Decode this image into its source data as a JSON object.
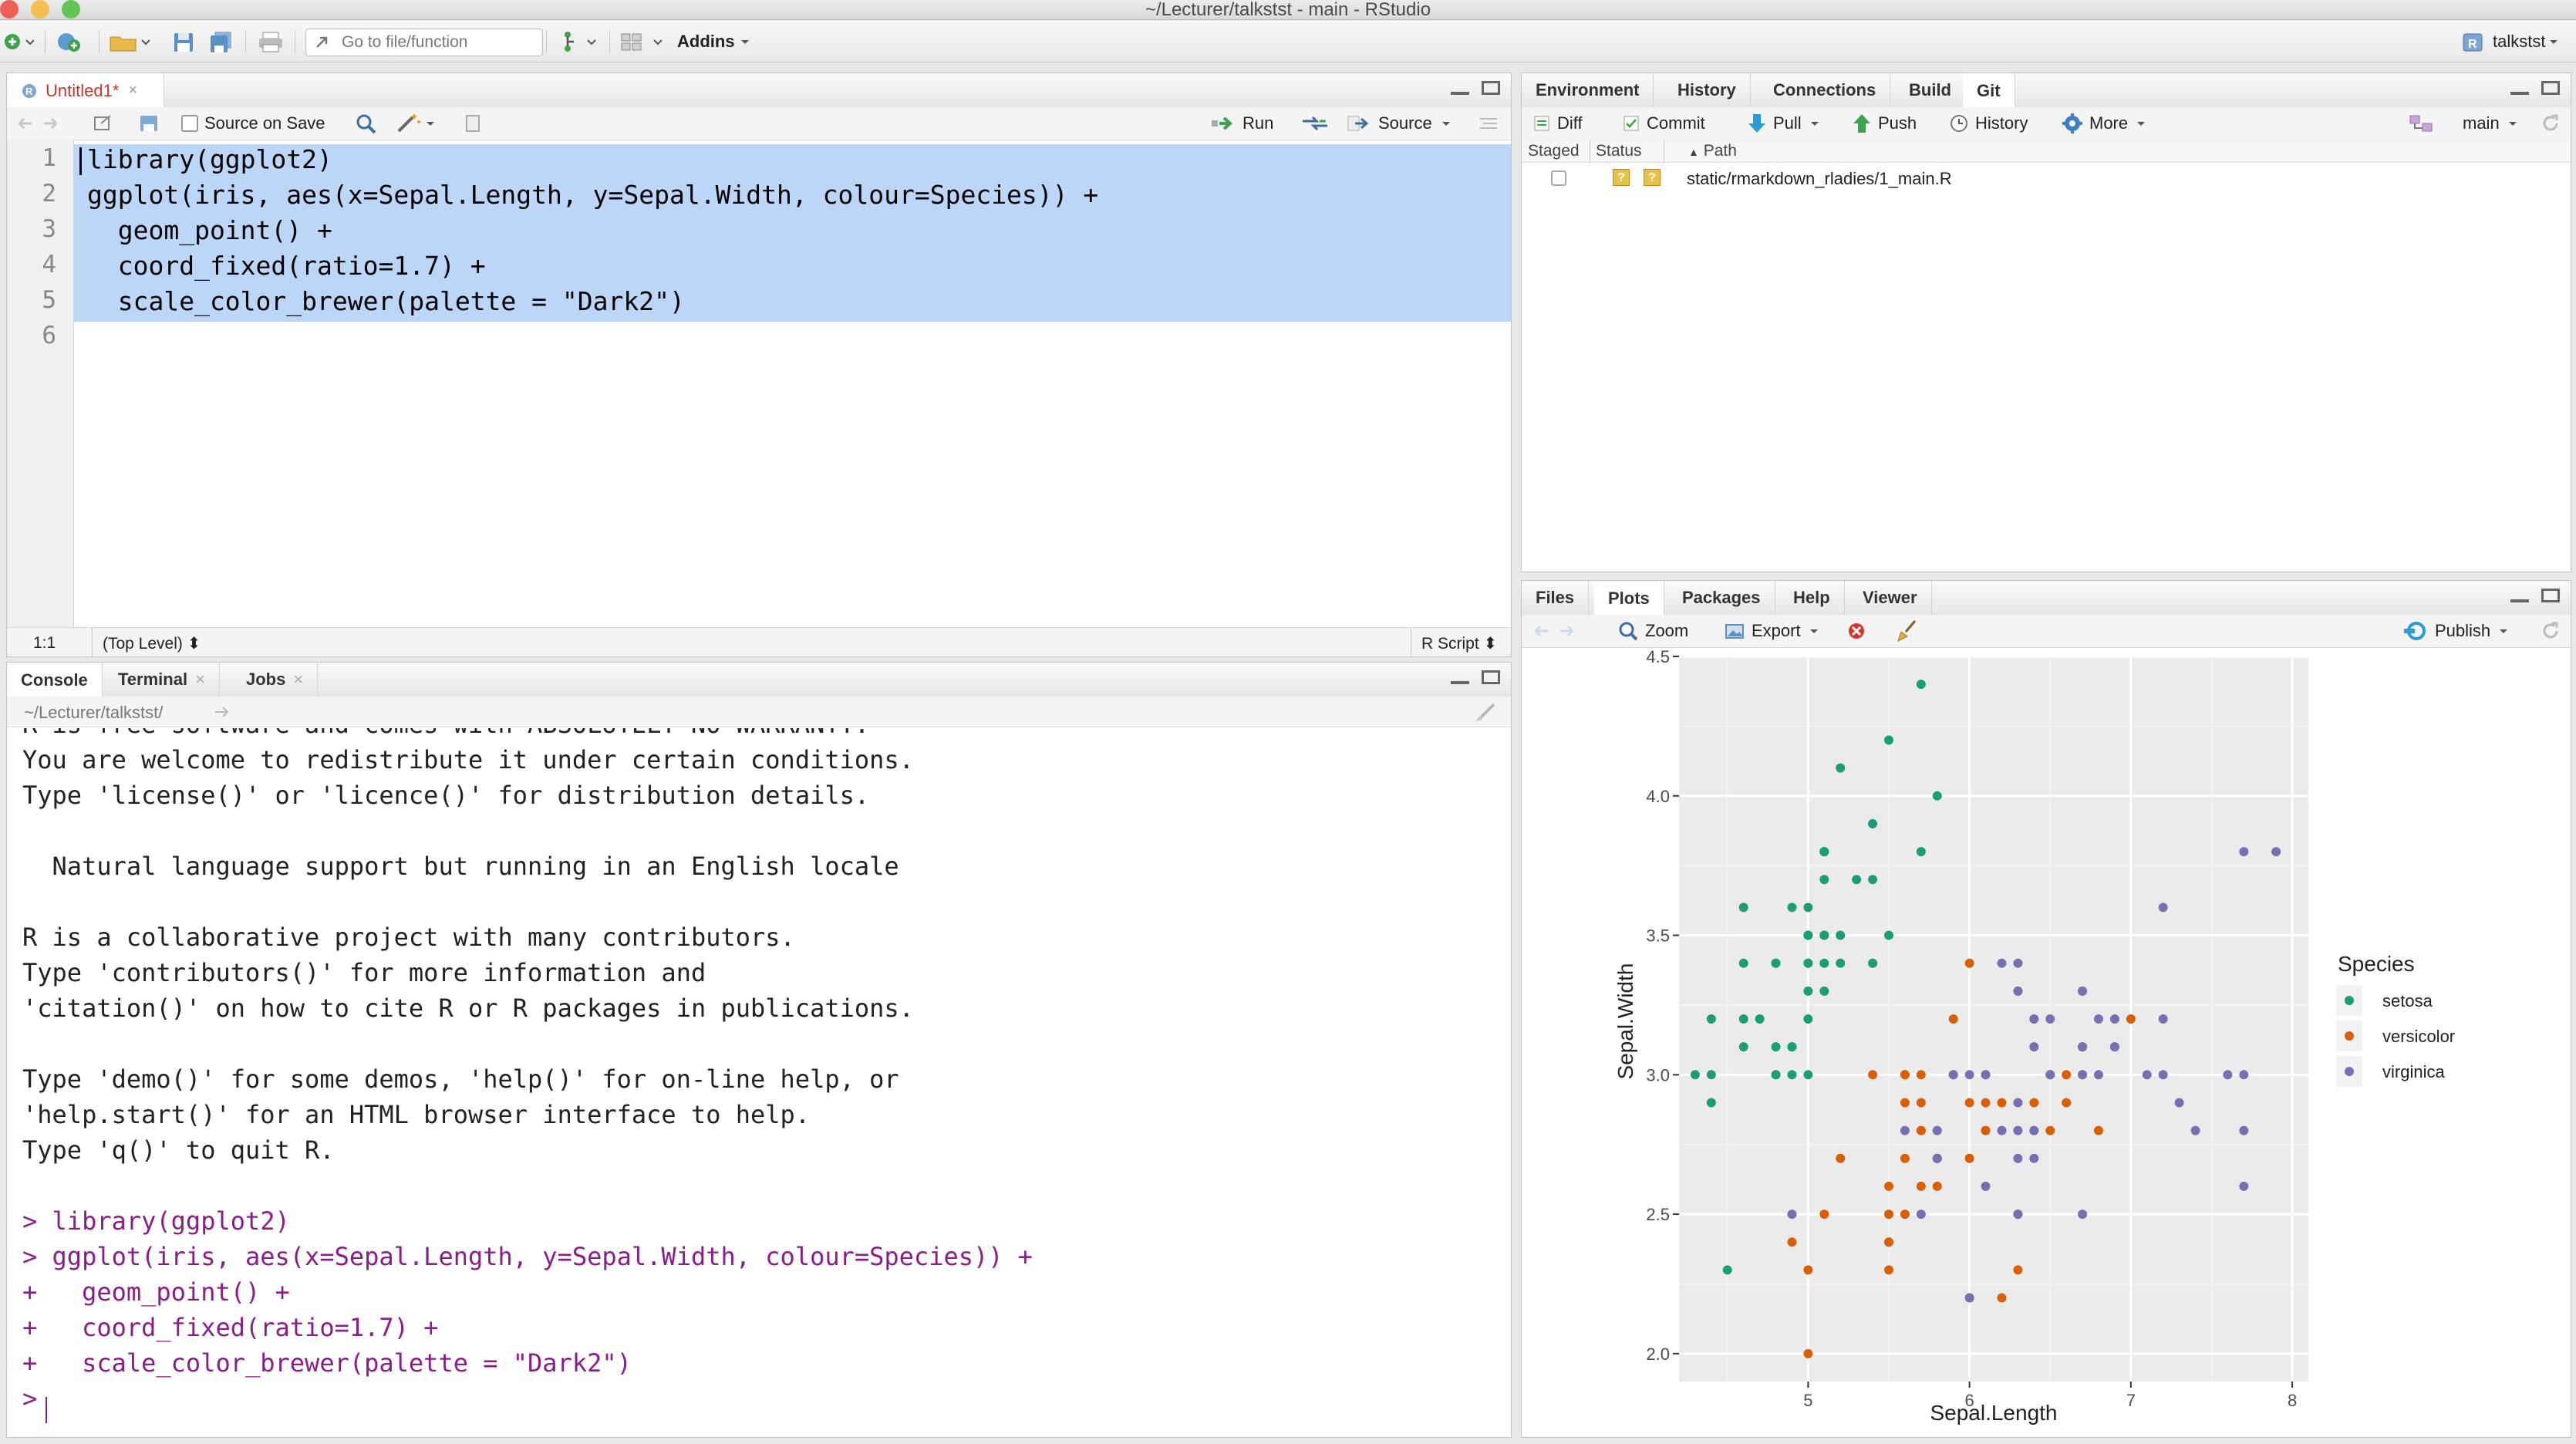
{
  "window": {
    "title": "~/Lecturer/talkstst - main - RStudio"
  },
  "toolbar": {
    "goto_placeholder": "Go to file/function",
    "addins_label": "Addins",
    "project_label": "talkstst"
  },
  "source": {
    "tab_label": "Untitled1*",
    "source_on_save_label": "Source on Save",
    "run_label": "Run",
    "source_label": "Source",
    "code_lines": [
      "library(ggplot2)",
      "ggplot(iris, aes(x=Sepal.Length, y=Sepal.Width, colour=Species)) +",
      "  geom_point() +",
      "  coord_fixed(ratio=1.7) +",
      "  scale_color_brewer(palette = \"Dark2\")",
      ""
    ],
    "line_numbers": [
      "1",
      "2",
      "3",
      "4",
      "5",
      "6"
    ],
    "status_position": "1:1",
    "status_scope": "(Top Level)",
    "status_type": "R Script"
  },
  "console": {
    "tabs": [
      "Console",
      "Terminal",
      "Jobs"
    ],
    "path": "~/Lecturer/talkstst/",
    "lines": [
      {
        "text": "R is free software and comes with ABSOLUTELY NO WARRANTY.",
        "kind": "out"
      },
      {
        "text": "You are welcome to redistribute it under certain conditions.",
        "kind": "out"
      },
      {
        "text": "Type 'license()' or 'licence()' for distribution details.",
        "kind": "out"
      },
      {
        "text": "",
        "kind": "out"
      },
      {
        "text": "  Natural language support but running in an English locale",
        "kind": "out"
      },
      {
        "text": "",
        "kind": "out"
      },
      {
        "text": "R is a collaborative project with many contributors.",
        "kind": "out"
      },
      {
        "text": "Type 'contributors()' for more information and",
        "kind": "out"
      },
      {
        "text": "'citation()' on how to cite R or R packages in publications.",
        "kind": "out"
      },
      {
        "text": "",
        "kind": "out"
      },
      {
        "text": "Type 'demo()' for some demos, 'help()' for on-line help, or",
        "kind": "out"
      },
      {
        "text": "'help.start()' for an HTML browser interface to help.",
        "kind": "out"
      },
      {
        "text": "Type 'q()' to quit R.",
        "kind": "out"
      },
      {
        "text": "",
        "kind": "out"
      },
      {
        "text": "> library(ggplot2)",
        "kind": "cmd"
      },
      {
        "text": "> ggplot(iris, aes(x=Sepal.Length, y=Sepal.Width, colour=Species)) +",
        "kind": "cmd"
      },
      {
        "text": "+   geom_point() +",
        "kind": "cmd"
      },
      {
        "text": "+   coord_fixed(ratio=1.7) +",
        "kind": "cmd"
      },
      {
        "text": "+   scale_color_brewer(palette = \"Dark2\")",
        "kind": "cmd"
      },
      {
        "text": "> ",
        "kind": "cmd"
      }
    ]
  },
  "env_pane": {
    "tabs": [
      "Environment",
      "History",
      "Connections",
      "Build",
      "Git"
    ],
    "git_toolbar": {
      "diff": "Diff",
      "commit": "Commit",
      "pull": "Pull",
      "push": "Push",
      "history": "History",
      "more": "More",
      "branch": "main"
    },
    "columns": {
      "staged": "Staged",
      "status": "Status",
      "path": "Path"
    },
    "rows": [
      {
        "path": "static/rmarkdown_rladies/1_main.R",
        "status": "?"
      }
    ]
  },
  "files_pane": {
    "tabs": [
      "Files",
      "Plots",
      "Packages",
      "Help",
      "Viewer"
    ],
    "zoom_label": "Zoom",
    "export_label": "Export",
    "publish_label": "Publish"
  },
  "chart_data": {
    "type": "scatter",
    "title": "",
    "xlabel": "Sepal.Length",
    "ylabel": "Sepal.Width",
    "xlim": [
      4.2,
      8.1
    ],
    "ylim": [
      1.9,
      4.5
    ],
    "xticks": [
      5,
      6,
      7,
      8
    ],
    "yticks": [
      2.0,
      2.5,
      3.0,
      3.5,
      4.0,
      4.5
    ],
    "ytick_labels": [
      "2.0",
      "2.5",
      "3.0",
      "3.5",
      "4.0",
      "4.5"
    ],
    "grid": true,
    "legend_title": "Species",
    "legend_position": "right",
    "series": [
      {
        "name": "setosa",
        "color": "#1b9e77",
        "points": [
          [
            5.1,
            3.5
          ],
          [
            4.9,
            3.0
          ],
          [
            4.7,
            3.2
          ],
          [
            4.6,
            3.1
          ],
          [
            5.0,
            3.6
          ],
          [
            5.4,
            3.9
          ],
          [
            4.6,
            3.4
          ],
          [
            5.0,
            3.4
          ],
          [
            4.4,
            2.9
          ],
          [
            4.9,
            3.1
          ],
          [
            5.4,
            3.7
          ],
          [
            4.8,
            3.4
          ],
          [
            4.8,
            3.0
          ],
          [
            4.3,
            3.0
          ],
          [
            5.8,
            4.0
          ],
          [
            5.7,
            4.4
          ],
          [
            5.4,
            3.9
          ],
          [
            5.1,
            3.5
          ],
          [
            5.7,
            3.8
          ],
          [
            5.1,
            3.8
          ],
          [
            5.4,
            3.4
          ],
          [
            5.1,
            3.7
          ],
          [
            4.6,
            3.6
          ],
          [
            5.1,
            3.3
          ],
          [
            4.8,
            3.4
          ],
          [
            5.0,
            3.0
          ],
          [
            5.0,
            3.4
          ],
          [
            5.2,
            3.5
          ],
          [
            5.2,
            3.4
          ],
          [
            4.7,
            3.2
          ],
          [
            4.8,
            3.1
          ],
          [
            5.4,
            3.4
          ],
          [
            5.2,
            4.1
          ],
          [
            5.5,
            4.2
          ],
          [
            4.9,
            3.1
          ],
          [
            5.0,
            3.2
          ],
          [
            5.5,
            3.5
          ],
          [
            4.9,
            3.6
          ],
          [
            4.4,
            3.0
          ],
          [
            5.1,
            3.4
          ],
          [
            5.0,
            3.5
          ],
          [
            4.5,
            2.3
          ],
          [
            4.4,
            3.2
          ],
          [
            5.0,
            3.5
          ],
          [
            5.1,
            3.8
          ],
          [
            4.8,
            3.0
          ],
          [
            5.1,
            3.8
          ],
          [
            4.6,
            3.2
          ],
          [
            5.3,
            3.7
          ],
          [
            5.0,
            3.3
          ]
        ]
      },
      {
        "name": "versicolor",
        "color": "#d95f02",
        "points": [
          [
            7.0,
            3.2
          ],
          [
            6.4,
            3.2
          ],
          [
            6.9,
            3.1
          ],
          [
            5.5,
            2.3
          ],
          [
            6.5,
            2.8
          ],
          [
            5.7,
            2.8
          ],
          [
            6.3,
            3.3
          ],
          [
            4.9,
            2.4
          ],
          [
            6.6,
            2.9
          ],
          [
            5.2,
            2.7
          ],
          [
            5.0,
            2.0
          ],
          [
            5.9,
            3.0
          ],
          [
            6.0,
            2.2
          ],
          [
            6.1,
            2.9
          ],
          [
            5.6,
            2.9
          ],
          [
            6.7,
            3.1
          ],
          [
            5.6,
            3.0
          ],
          [
            5.8,
            2.7
          ],
          [
            6.2,
            2.2
          ],
          [
            5.6,
            2.5
          ],
          [
            5.9,
            3.2
          ],
          [
            6.1,
            2.8
          ],
          [
            6.3,
            2.5
          ],
          [
            6.1,
            2.8
          ],
          [
            6.4,
            2.9
          ],
          [
            6.6,
            3.0
          ],
          [
            6.8,
            2.8
          ],
          [
            6.7,
            3.0
          ],
          [
            6.0,
            2.9
          ],
          [
            5.7,
            2.6
          ],
          [
            5.5,
            2.4
          ],
          [
            5.5,
            2.4
          ],
          [
            5.8,
            2.7
          ],
          [
            6.0,
            2.7
          ],
          [
            5.4,
            3.0
          ],
          [
            6.0,
            3.4
          ],
          [
            6.7,
            3.1
          ],
          [
            6.3,
            2.3
          ],
          [
            5.6,
            3.0
          ],
          [
            5.5,
            2.5
          ],
          [
            5.5,
            2.6
          ],
          [
            6.1,
            3.0
          ],
          [
            5.8,
            2.6
          ],
          [
            5.0,
            2.3
          ],
          [
            5.6,
            2.7
          ],
          [
            5.7,
            3.0
          ],
          [
            5.7,
            2.9
          ],
          [
            6.2,
            2.9
          ],
          [
            5.1,
            2.5
          ],
          [
            5.7,
            2.8
          ]
        ]
      },
      {
        "name": "virginica",
        "color": "#7570b3",
        "points": [
          [
            6.3,
            3.3
          ],
          [
            5.8,
            2.7
          ],
          [
            7.1,
            3.0
          ],
          [
            6.3,
            2.9
          ],
          [
            6.5,
            3.0
          ],
          [
            7.6,
            3.0
          ],
          [
            4.9,
            2.5
          ],
          [
            7.3,
            2.9
          ],
          [
            6.7,
            2.5
          ],
          [
            7.2,
            3.6
          ],
          [
            6.5,
            3.2
          ],
          [
            6.4,
            2.7
          ],
          [
            6.8,
            3.0
          ],
          [
            5.7,
            2.5
          ],
          [
            5.8,
            2.8
          ],
          [
            6.4,
            3.2
          ],
          [
            6.5,
            3.0
          ],
          [
            7.7,
            3.8
          ],
          [
            7.7,
            2.6
          ],
          [
            6.0,
            2.2
          ],
          [
            6.9,
            3.2
          ],
          [
            5.6,
            2.8
          ],
          [
            7.7,
            2.8
          ],
          [
            6.3,
            2.7
          ],
          [
            6.7,
            3.3
          ],
          [
            7.2,
            3.2
          ],
          [
            6.2,
            2.8
          ],
          [
            6.1,
            3.0
          ],
          [
            6.4,
            2.8
          ],
          [
            7.2,
            3.0
          ],
          [
            7.4,
            2.8
          ],
          [
            7.9,
            3.8
          ],
          [
            6.4,
            2.8
          ],
          [
            6.3,
            2.8
          ],
          [
            6.1,
            2.6
          ],
          [
            7.7,
            3.0
          ],
          [
            6.3,
            3.4
          ],
          [
            6.4,
            3.1
          ],
          [
            6.0,
            3.0
          ],
          [
            6.9,
            3.1
          ],
          [
            6.7,
            3.1
          ],
          [
            6.9,
            3.1
          ],
          [
            5.8,
            2.7
          ],
          [
            6.8,
            3.2
          ],
          [
            6.7,
            3.3
          ],
          [
            6.7,
            3.0
          ],
          [
            6.3,
            2.5
          ],
          [
            6.5,
            3.0
          ],
          [
            6.2,
            3.4
          ],
          [
            5.9,
            3.0
          ]
        ]
      }
    ]
  }
}
